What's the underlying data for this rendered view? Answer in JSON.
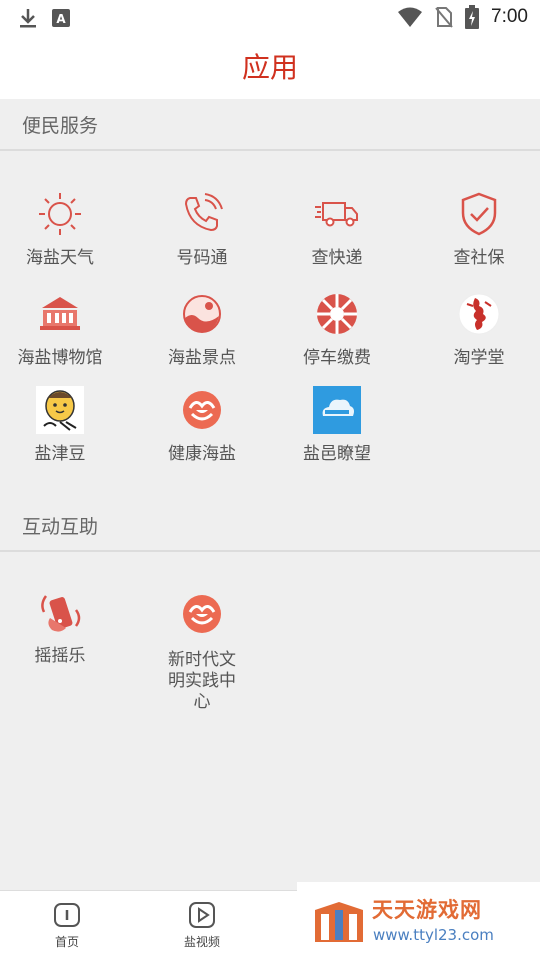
{
  "status_bar": {
    "time": "7:00",
    "icons": [
      "download-icon",
      "keyboard-a-icon",
      "wifi-icon",
      "no-sim-icon",
      "battery-charging-icon"
    ]
  },
  "header": {
    "title": "应用"
  },
  "sections": {
    "convenience": {
      "title": "便民服务",
      "items": [
        {
          "label": "海盐天气",
          "icon": "sun-icon"
        },
        {
          "label": "号码通",
          "icon": "phone-icon"
        },
        {
          "label": "查快递",
          "icon": "truck-icon"
        },
        {
          "label": "查社保",
          "icon": "shield-check-icon"
        },
        {
          "label": "海盐博物馆",
          "icon": "museum-icon"
        },
        {
          "label": "海盐景点",
          "icon": "scenery-icon"
        },
        {
          "label": "停车缴费",
          "icon": "wheel-icon"
        },
        {
          "label": "淘学堂",
          "icon": "dancer-icon"
        },
        {
          "label": "盐津豆",
          "icon": "bean-mascot-icon"
        },
        {
          "label": "健康海盐",
          "icon": "health-icon"
        },
        {
          "label": "盐邑瞭望",
          "icon": "cloud-app-icon"
        }
      ]
    },
    "interaction": {
      "title": "互动互助",
      "items": [
        {
          "label": "摇摇乐",
          "icon": "shake-phone-icon"
        },
        {
          "label": "新时代文明实践中心",
          "icon": "civilization-icon"
        }
      ]
    }
  },
  "bottom_nav": {
    "tabs": [
      {
        "label": "首页",
        "icon": "home-info-icon"
      },
      {
        "label": "盐视频",
        "icon": "play-icon"
      }
    ]
  },
  "watermark": {
    "text": "天天游戏网",
    "url": "www.ttyl23.com"
  },
  "colors": {
    "accent": "#d0311f",
    "icon_red": "#d9534a"
  }
}
